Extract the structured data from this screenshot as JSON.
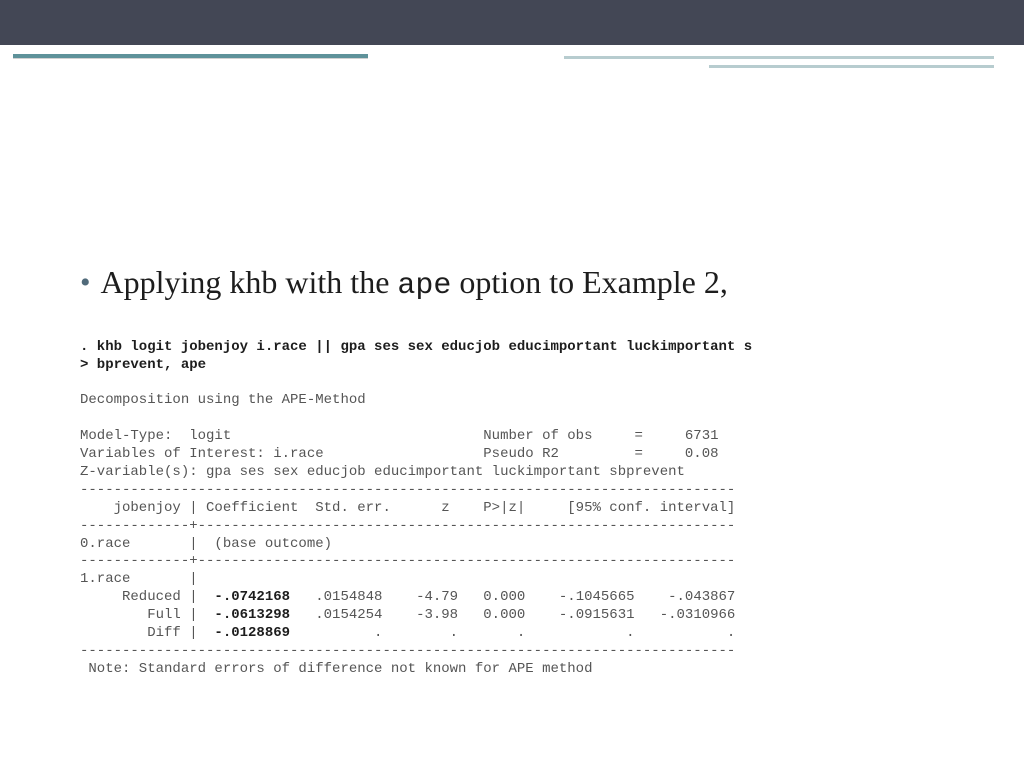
{
  "bullet": {
    "dot": "•",
    "prefix": "Applying khb with the ",
    "code": "ape",
    "suffix": " option to Example 2,"
  },
  "stata": {
    "cmd1": ". khb logit jobenjoy i.race || gpa ses sex educjob educimportant luckimportant s",
    "cmd2": "> bprevent, ape",
    "title": "Decomposition using the APE-Method",
    "model_line": "Model-Type:  logit                              Number of obs     =     6731",
    "vars_line": "Variables of Interest: i.race                   Pseudo R2         =     0.08",
    "zvars_line": "Z-variable(s): gpa ses sex educjob educimportant luckimportant sbprevent",
    "rule80": "------------------------------------------------------------------------------",
    "header": "    jobenjoy | Coefficient  Std. err.      z    P>|z|     [95% conf. interval]",
    "rule_t": "-------------+----------------------------------------------------------------",
    "base": "0.race       |  (base outcome)",
    "grp": "1.race       |",
    "reduced_l": "     Reduced |  ",
    "reduced_c": "-.0742168",
    "reduced_r": "   .0154848    -4.79   0.000    -.1045665    -.043867",
    "full_l": "        Full |  ",
    "full_c": "-.0613298",
    "full_r": "   .0154254    -3.98   0.000    -.0915631   -.0310966",
    "diff_l": "        Diff |  ",
    "diff_c": "-.0128869",
    "diff_r": "          .        .       .            .           .",
    "note": " Note: Standard errors of difference not known for APE method"
  }
}
